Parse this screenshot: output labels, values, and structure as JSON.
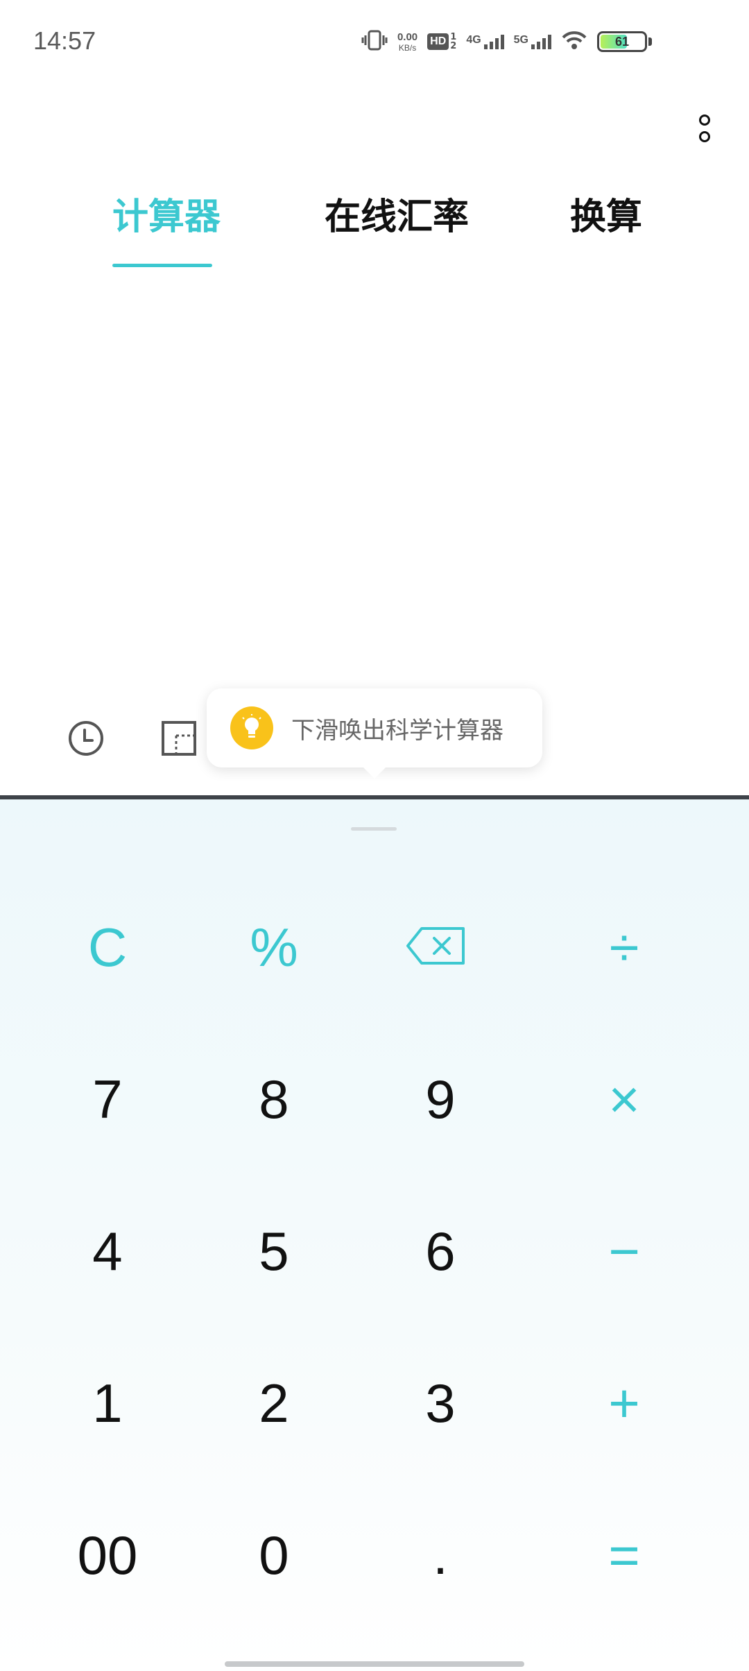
{
  "status_bar": {
    "time": "14:57",
    "net_speed": "0.00",
    "net_speed_unit": "KB/s",
    "hd_label": "HD",
    "sim_top": "1",
    "sim_bottom": "2",
    "signal1_label": "4G",
    "signal2_label": "5G",
    "battery_level": "61",
    "battery_fraction": 0.61
  },
  "tabs": [
    {
      "label": "计算器",
      "active": true
    },
    {
      "label": "在线汇率",
      "active": false
    },
    {
      "label": "换算",
      "active": false
    }
  ],
  "tooltip": {
    "text": "下滑唤出科学计算器"
  },
  "keypad": {
    "rows": [
      [
        {
          "label": "C",
          "accent": true
        },
        {
          "label": "%",
          "accent": true
        },
        {
          "label": "",
          "accent": true,
          "icon": "backspace-icon"
        },
        {
          "label": "÷",
          "accent": true
        }
      ],
      [
        {
          "label": "7"
        },
        {
          "label": "8"
        },
        {
          "label": "9"
        },
        {
          "label": "×",
          "accent": true
        }
      ],
      [
        {
          "label": "4"
        },
        {
          "label": "5"
        },
        {
          "label": "6"
        },
        {
          "label": "−",
          "accent": true
        }
      ],
      [
        {
          "label": "1"
        },
        {
          "label": "2"
        },
        {
          "label": "3"
        },
        {
          "label": "+",
          "accent": true
        }
      ],
      [
        {
          "label": "00"
        },
        {
          "label": "0"
        },
        {
          "label": "."
        },
        {
          "label": "=",
          "accent": true
        }
      ]
    ]
  },
  "colors": {
    "accent": "#3cc8d0",
    "bulb": "#f9c21a",
    "divider": "#3e4349"
  }
}
